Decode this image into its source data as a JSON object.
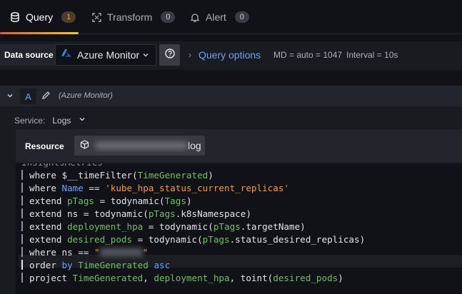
{
  "tabs": [
    {
      "label": "Query",
      "count": "1",
      "icon": "database-icon",
      "active": true
    },
    {
      "label": "Transform",
      "count": "0",
      "icon": "transform-icon",
      "active": false
    },
    {
      "label": "Alert",
      "count": "0",
      "icon": "bell-icon",
      "active": false
    }
  ],
  "datasource": {
    "label": "Data source",
    "selected": "Azure Monitor",
    "query_options_label": "Query options",
    "md": "MD = auto = 1047",
    "interval": "Interval = 10s"
  },
  "query": {
    "ref_id": "A",
    "ds_hint": "(Azure Monitor)",
    "service_label": "Service:",
    "service_value": "Logs",
    "resource_label": "Resource",
    "resource_suffix": "log"
  },
  "editor": {
    "first_line": "InsightsMetrics",
    "lines": [
      {
        "pre": "where ",
        "tokens": [
          [
            "$__timeFilter",
            "w"
          ],
          [
            "(",
            "w"
          ],
          [
            "TimeGenerated",
            "g"
          ],
          [
            ")",
            "w"
          ]
        ]
      },
      {
        "pre": "where ",
        "tokens": [
          [
            "Name",
            "b"
          ],
          [
            " == ",
            "w"
          ],
          [
            "'kube_hpa_status_current_replicas'",
            "o"
          ]
        ]
      },
      {
        "pre": "extend ",
        "tokens": [
          [
            "pTags",
            "g"
          ],
          [
            " = ",
            "w"
          ],
          [
            "todynamic",
            "w"
          ],
          [
            "(",
            "w"
          ],
          [
            "Tags",
            "g"
          ],
          [
            ")",
            "w"
          ]
        ]
      },
      {
        "pre": "extend ",
        "tokens": [
          [
            "ns",
            "w"
          ],
          [
            " = ",
            "w"
          ],
          [
            "todynamic",
            "w"
          ],
          [
            "(",
            "w"
          ],
          [
            "pTags",
            "g"
          ],
          [
            ".k8sNamespace)",
            "w"
          ]
        ]
      },
      {
        "pre": "extend ",
        "tokens": [
          [
            "deployment_hpa",
            "g"
          ],
          [
            " = ",
            "w"
          ],
          [
            "todynamic",
            "w"
          ],
          [
            "(",
            "w"
          ],
          [
            "pTags",
            "g"
          ],
          [
            ".targetName)",
            "w"
          ]
        ]
      },
      {
        "pre": "extend ",
        "tokens": [
          [
            "desired_pods",
            "g"
          ],
          [
            " = ",
            "w"
          ],
          [
            "todynamic",
            "w"
          ],
          [
            "(",
            "w"
          ],
          [
            "pTags",
            "g"
          ],
          [
            ".status_desired_replicas)",
            "w"
          ]
        ]
      },
      {
        "pre": "where ",
        "tokens": [
          [
            "ns",
            "w"
          ],
          [
            " == ",
            "w"
          ],
          [
            "\"",
            "o"
          ],
          [
            "BLUR",
            "x"
          ],
          [
            "\"",
            "o"
          ]
        ]
      },
      {
        "pre": "order ",
        "tokens": [
          [
            "by",
            "b"
          ],
          [
            " ",
            "w"
          ],
          [
            "TimeGenerated",
            "g"
          ],
          [
            " ",
            "w"
          ],
          [
            "asc",
            "b"
          ]
        ]
      },
      {
        "pre": "project ",
        "tokens": [
          [
            "TimeGenerated",
            "g"
          ],
          [
            ", ",
            "w"
          ],
          [
            "deployment_hpa",
            "g"
          ],
          [
            ", ",
            "w"
          ],
          [
            "toint",
            "w"
          ],
          [
            "(",
            "w"
          ],
          [
            "desired_pods",
            "g"
          ],
          [
            ")",
            "w"
          ]
        ]
      }
    ]
  },
  "colors": {
    "keyword": "#6e9fff",
    "green": "#73bf69",
    "string": "#ff9830",
    "accent": "#6e9fff"
  }
}
